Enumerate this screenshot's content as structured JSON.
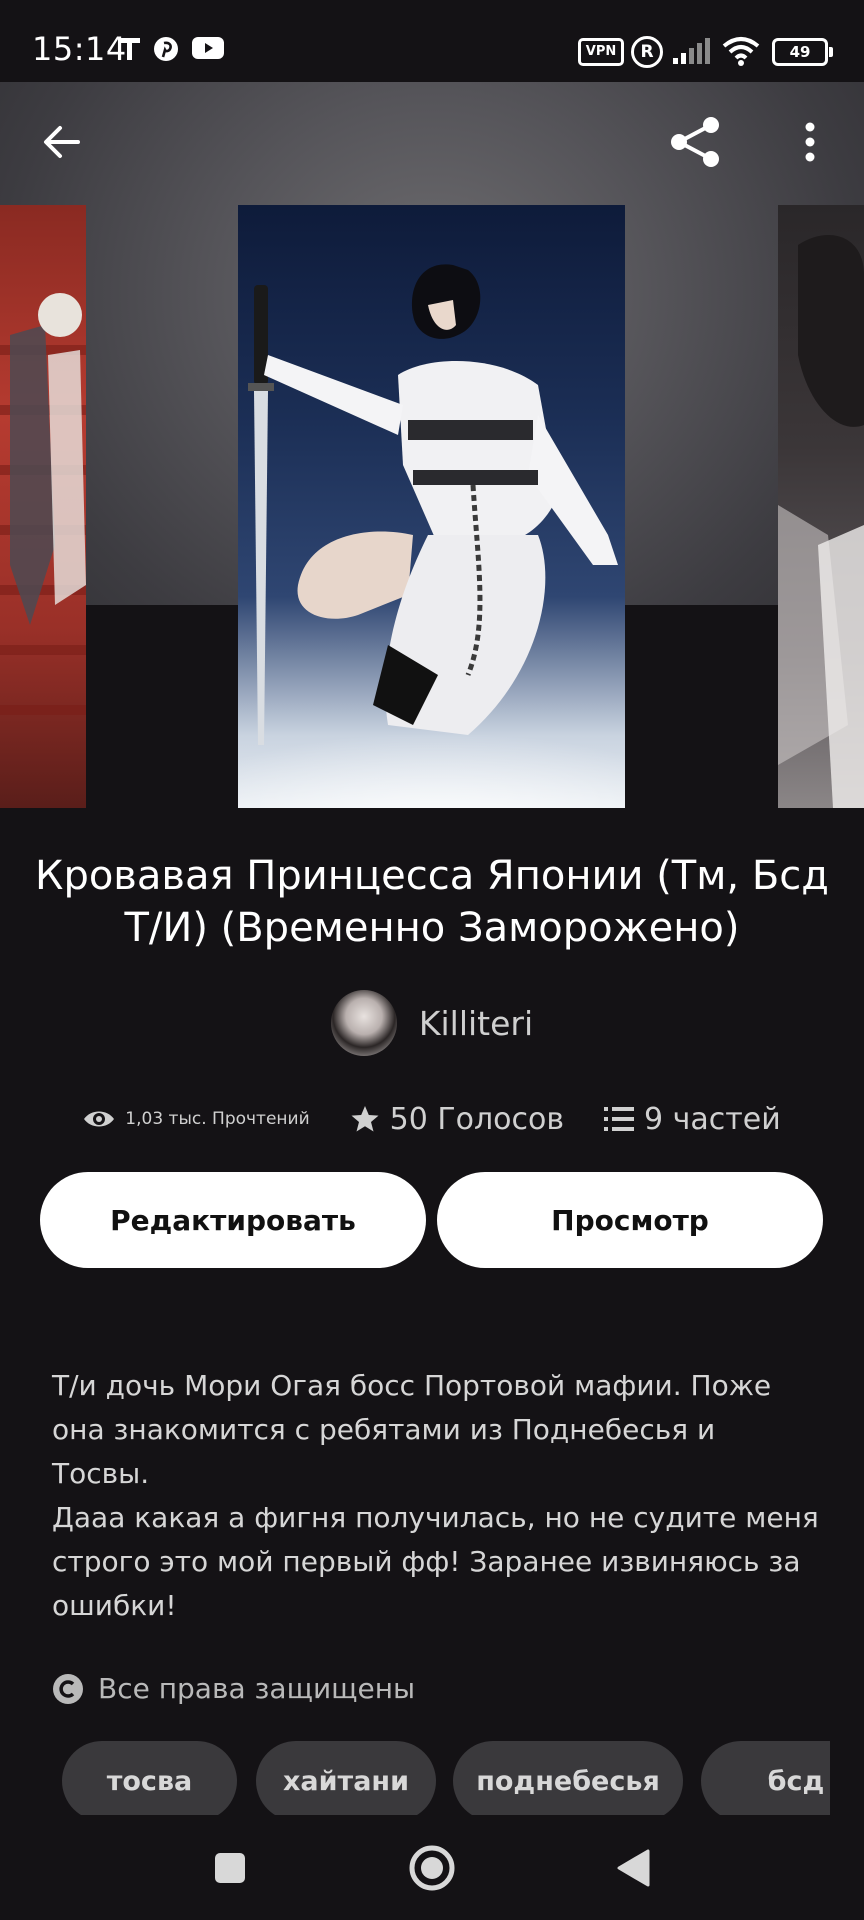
{
  "status_bar": {
    "time": "15:14",
    "vpn": "VPN",
    "r_badge": "R",
    "battery": "49",
    "icons": [
      "tumblr-icon",
      "pinterest-icon",
      "youtube-icon",
      "signal-icon",
      "wifi-icon"
    ]
  },
  "header": {
    "icons": [
      "back-arrow-icon",
      "share-icon",
      "more-vert-icon"
    ]
  },
  "story": {
    "title": "Кровавая Принцесса Японии (Тм, Бсд Т/И) (Временно Заморожено)",
    "author": "Killiteri",
    "reads": "1,03 тыс. Прочтений",
    "votes": "50 Голосов",
    "parts": "9 частей",
    "description": "Т/и дочь Мори Огая босс Портовой мафии. Поже\nона знакомится с ребятами из Поднебесья и\nТосвы.\nДааа какая а фигня получилась, но не судите меня\nстрого это мой первый фф! Заранее извиняюсь за\nошибки!",
    "rights": "Все права защищены"
  },
  "buttons": {
    "edit": "Редактировать",
    "view": "Просмотр"
  },
  "tags": [
    "тосва",
    "хайтани",
    "поднебесья",
    "бсд"
  ],
  "colors": {
    "background": "#141215",
    "button_bg": "#ffffff",
    "tag_bg": "#3a393c"
  },
  "navbar": {
    "icons": [
      "recents-square-icon",
      "home-circle-icon",
      "back-triangle-icon"
    ]
  }
}
